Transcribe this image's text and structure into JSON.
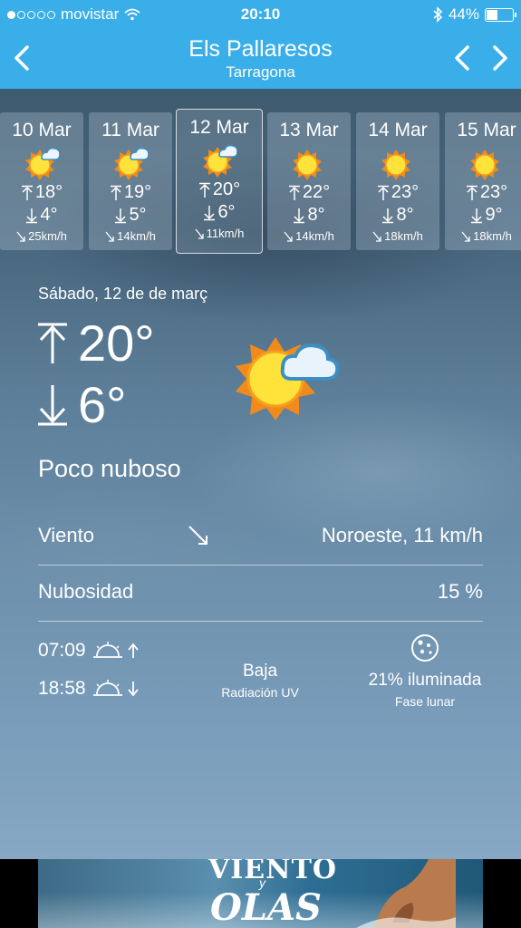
{
  "status_bar": {
    "carrier": "movistar",
    "time": "20:10",
    "battery": "44%",
    "battery_level": 0.44,
    "signal_bars": 1
  },
  "nav": {
    "title": "Els Pallaresos",
    "subtitle": "Tarragona",
    "back_icon": "chevron-left-icon",
    "prev_icon": "chevron-left-icon",
    "next_icon": "chevron-right-icon"
  },
  "days": [
    {
      "date": "10 Mar",
      "high": "18°",
      "low": "4°",
      "wind": "25km/h",
      "icon": "sun-cloud-icon",
      "selected": false
    },
    {
      "date": "11 Mar",
      "high": "19°",
      "low": "5°",
      "wind": "14km/h",
      "icon": "sun-cloud-icon",
      "selected": false
    },
    {
      "date": "12 Mar",
      "high": "20°",
      "low": "6°",
      "wind": "11km/h",
      "icon": "sun-cloud-icon",
      "selected": true
    },
    {
      "date": "13 Mar",
      "high": "22°",
      "low": "8°",
      "wind": "14km/h",
      "icon": "sun-icon",
      "selected": false
    },
    {
      "date": "14 Mar",
      "high": "23°",
      "low": "8°",
      "wind": "18km/h",
      "icon": "sun-icon",
      "selected": false
    },
    {
      "date": "15 Mar",
      "high": "23°",
      "low": "9°",
      "wind": "18km/h",
      "icon": "sun-icon",
      "selected": false
    }
  ],
  "detail": {
    "date": "Sábado, 12 de de març",
    "high": "20°",
    "low": "6°",
    "condition": "Poco nuboso",
    "wind_label": "Viento",
    "wind_value": "Noroeste, 11 km/h",
    "cloud_label": "Nubosidad",
    "cloud_value": "15 %",
    "sunrise": "07:09",
    "sunset": "18:58",
    "uv_value": "Baja",
    "uv_label": "Radiación UV",
    "moon_value": "21% iluminada",
    "moon_label": "Fase lunar"
  },
  "ad": {
    "line1": "VIENTO",
    "line_y": "y",
    "line2": "OLAS"
  },
  "colors": {
    "nav_blue": "#3aaee8",
    "sun_yellow": "#ffe23a",
    "sun_orange": "#f08a1c"
  }
}
